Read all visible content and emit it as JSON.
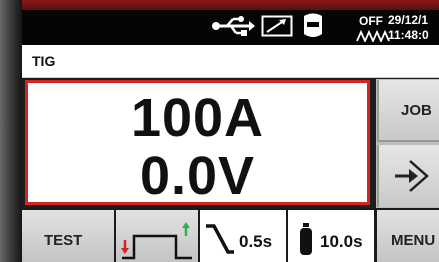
{
  "status_bar": {
    "icons": [
      "usb-icon",
      "signal-arrow-icon",
      "welding-helmet-icon",
      "arc-wave-icon"
    ],
    "off_label": "OFF",
    "date": "29/12/1",
    "time": "11:48:0"
  },
  "mode": {
    "label": "TIG"
  },
  "display": {
    "current": "100A",
    "voltage": "0.0V"
  },
  "side_buttons": {
    "job_label": "JOB",
    "enter_icon": "enter-arrow-icon"
  },
  "bottom_buttons": {
    "test_label": "TEST",
    "cycle_icon": "welding-cycle-icon",
    "downslope_icon": "downslope-icon",
    "downslope_value": "0.5s",
    "postgas_icon": "gas-cylinder-icon",
    "postgas_value": "10.0s",
    "menu_label": "MENU"
  },
  "colors": {
    "accent_red": "#d42525",
    "status_bg": "#050505",
    "button_gray": "#d0d0d0"
  }
}
